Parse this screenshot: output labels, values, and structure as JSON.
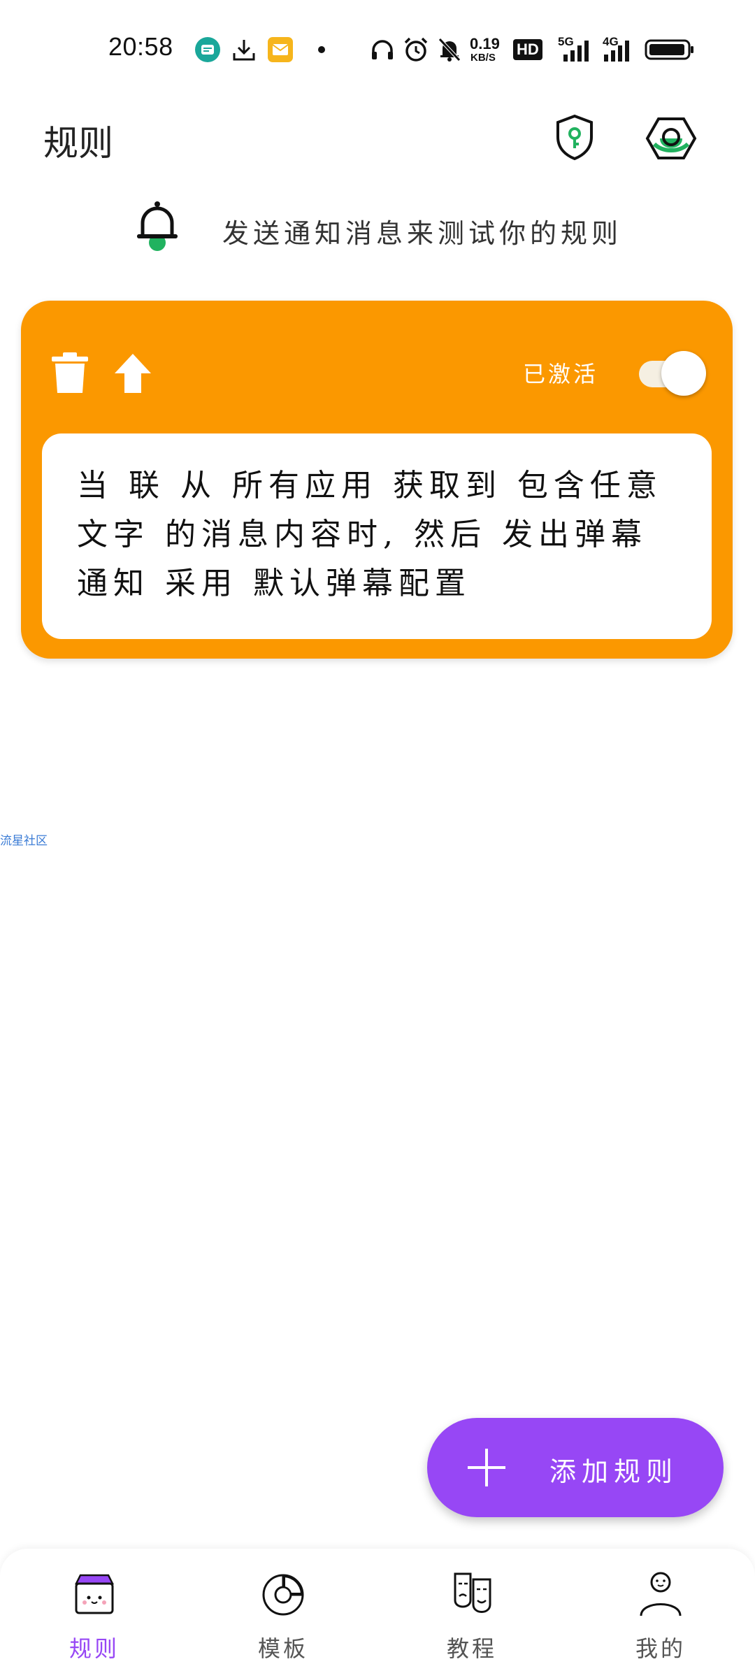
{
  "status_bar": {
    "time": "20:58",
    "net_speed_value": "0.19",
    "net_speed_unit": "KB/S",
    "hd_badge": "HD",
    "signal1": "5G",
    "signal2": "4G",
    "icons": [
      "app-notification-icon",
      "download-icon",
      "mail-icon",
      "dot-icon",
      "headphones-icon",
      "alarm-icon",
      "mute-icon",
      "signal-icon",
      "battery-icon"
    ]
  },
  "header": {
    "title": "规则",
    "icons": [
      "shield-key-icon",
      "hexagon-settings-icon"
    ]
  },
  "test_notification": {
    "label": "发送通知消息来测试你的规则",
    "icon": "bell-icon"
  },
  "rule_card": {
    "active_label": "已激活",
    "toggle_on": true,
    "description": "当 从 所有应用 获取到 包含任意文字 的消息内容时, 然后 发出弹幕通知 采用 默认弹幕配置",
    "description_lines": [
      "当 联 从 所有应用 获取到 包含任意",
      "文字 的消息内容时, 然后 发出弹幕",
      "通知 采用 默认弹幕配置"
    ],
    "buttons": [
      "delete-icon",
      "move-up-icon"
    ],
    "colors": {
      "card": "#fb9800",
      "body": "#ffffff"
    }
  },
  "watermark": "流星社区",
  "fab": {
    "label": "添加规则",
    "color": "#9747f5"
  },
  "bottom_nav": {
    "items": [
      {
        "label": "规则",
        "icon": "rules-box-icon",
        "active": true
      },
      {
        "label": "模板",
        "icon": "template-chart-icon",
        "active": false
      },
      {
        "label": "教程",
        "icon": "tutorial-masks-icon",
        "active": false
      },
      {
        "label": "我的",
        "icon": "profile-person-icon",
        "active": false
      }
    ],
    "active_color": "#9747f5"
  }
}
